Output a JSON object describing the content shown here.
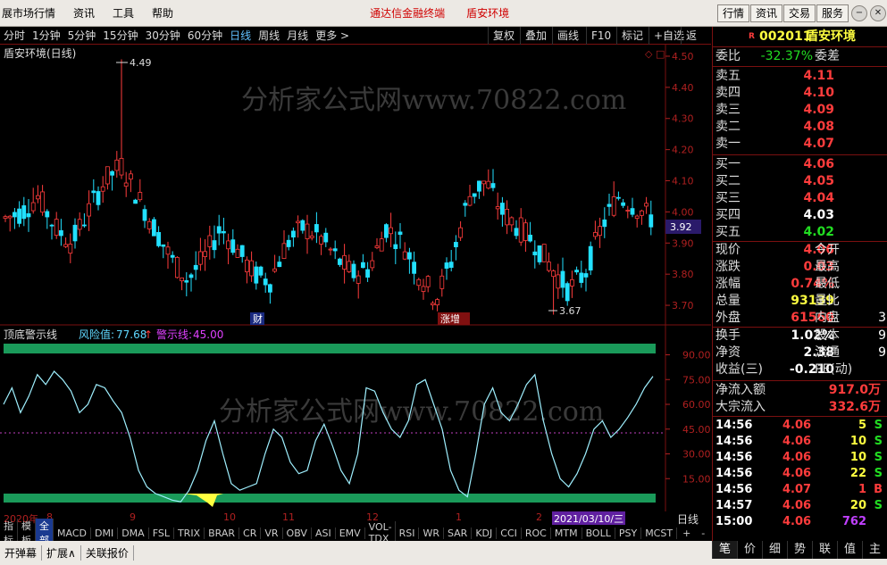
{
  "menu": [
    "展市场行情",
    "资讯",
    "工具",
    "帮助"
  ],
  "promo": [
    "通达信金融终端",
    "盾安环境"
  ],
  "top_buttons": [
    "行情",
    "资讯",
    "交易",
    "服务"
  ],
  "periods": [
    "分时",
    "1分钟",
    "5分钟",
    "15分钟",
    "30分钟",
    "60分钟",
    "日线",
    "周线",
    "月线",
    "更多 >"
  ],
  "active_period": "日线",
  "tools": [
    "复权",
    "叠加",
    "画线",
    "F10",
    "标记",
    "+自选",
    "返回"
  ],
  "chart": {
    "title": "盾安环境(日线)",
    "watermark": "分析家公式网www.70822.com",
    "y_ticks": [
      "4.50",
      "4.40",
      "4.30",
      "4.20",
      "4.10",
      "4.00",
      "3.90",
      "3.80",
      "3.70"
    ],
    "price_tag": "3.92",
    "high_label": "4.49",
    "low_label": "3.67",
    "markers": [
      "财",
      "涨增"
    ]
  },
  "chart_data": {
    "type": "candlestick",
    "title": "盾安环境(日线)",
    "ylim": [
      3.66,
      4.52
    ],
    "x_months": [
      "2020年",
      "8",
      "9",
      "10",
      "11",
      "12",
      "1",
      "2"
    ],
    "high": 4.49,
    "low": 3.67,
    "current": 3.92,
    "indicator": {
      "name": "顶底警示线",
      "risk_label": "风险值:",
      "risk_value": "77.68",
      "warn_label": "警示线:",
      "warn_value": "45.00",
      "y_ticks": [
        "90.00",
        "75.00",
        "60.00",
        "45.00",
        "30.00",
        "15.00"
      ],
      "ylim": [
        0,
        100
      ]
    }
  },
  "sub_title": "顶底警示线",
  "date_cursor": "2021/03/10/三",
  "date_months": [
    "2020年",
    "8",
    "9",
    "10",
    "11",
    "12",
    "1",
    "2"
  ],
  "period_label": "日线",
  "bottom_tabs": [
    "指标",
    "模板",
    "全部",
    "MACD",
    "DMI",
    "DMA",
    "FSL",
    "TRIX",
    "BRAR",
    "CR",
    "VR",
    "OBV",
    "ASI",
    "EMV",
    "VOL-TDX",
    "RSI",
    "WR",
    "SAR",
    "KDJ",
    "CCI",
    "ROC",
    "MTM",
    "BOLL",
    "PSY",
    "MCST"
  ],
  "bottom_ctrl": [
    "+",
    "-",
    "0"
  ],
  "status_bar": [
    "开弹幕",
    "扩展∧",
    "关联报价"
  ],
  "stock": {
    "code": "002011",
    "name": "盾安环境",
    "flag": "R"
  },
  "order_ratio": {
    "label": "委比",
    "value": "-32.37%",
    "label2": "委差"
  },
  "sells": [
    {
      "label": "卖五",
      "price": "4.11"
    },
    {
      "label": "卖四",
      "price": "4.10"
    },
    {
      "label": "卖三",
      "price": "4.09"
    },
    {
      "label": "卖二",
      "price": "4.08"
    },
    {
      "label": "卖一",
      "price": "4.07"
    }
  ],
  "buys": [
    {
      "label": "买一",
      "price": "4.06"
    },
    {
      "label": "买二",
      "price": "4.05"
    },
    {
      "label": "买三",
      "price": "4.04"
    },
    {
      "label": "买四",
      "price": "4.03"
    },
    {
      "label": "买五",
      "price": "4.02"
    }
  ],
  "quote": [
    {
      "l": "现价",
      "v": "4.06",
      "l2": "今开"
    },
    {
      "l": "涨跌",
      "v": "0.03",
      "l2": "最高"
    },
    {
      "l": "涨幅",
      "v": "0.74%",
      "l2": "最低"
    },
    {
      "l": "总量",
      "v": "93139",
      "l2": "量比"
    },
    {
      "l": "外盘",
      "v": "61560",
      "l2": "内盘",
      "v2": "3"
    }
  ],
  "fund": [
    {
      "l": "换手",
      "v": "1.02%",
      "l2": "股本",
      "v2": "9"
    },
    {
      "l": "净资",
      "v": "2.38",
      "l2": "流通",
      "v2": "9"
    },
    {
      "l": "收益(三)",
      "v": "-0.210",
      "l2": "PE(动)"
    }
  ],
  "flows": [
    {
      "l": "净流入额",
      "v": "917.0万"
    },
    {
      "l": "大宗流入",
      "v": "332.6万"
    }
  ],
  "ticks": [
    {
      "t": "14:56",
      "p": "4.06",
      "v": "5",
      "d": "S"
    },
    {
      "t": "14:56",
      "p": "4.06",
      "v": "10",
      "d": "S"
    },
    {
      "t": "14:56",
      "p": "4.06",
      "v": "10",
      "d": "S"
    },
    {
      "t": "14:56",
      "p": "4.06",
      "v": "22",
      "d": "S"
    },
    {
      "t": "14:56",
      "p": "4.07",
      "v": "1",
      "d": "B"
    },
    {
      "t": "14:57",
      "p": "4.06",
      "v": "20",
      "d": "S"
    },
    {
      "t": "15:00",
      "p": "4.06",
      "v": "762",
      "d": ""
    }
  ],
  "right_tabs": [
    "笔",
    "价",
    "细",
    "势",
    "联",
    "值",
    "主"
  ]
}
